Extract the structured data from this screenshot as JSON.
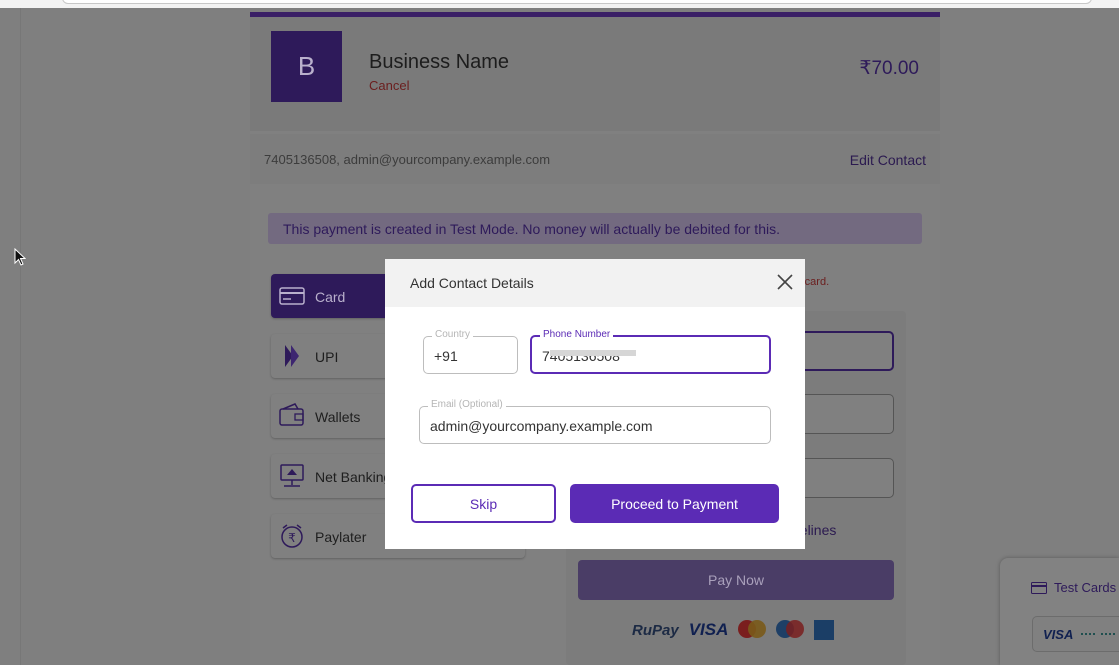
{
  "header": {
    "logo_letter": "B",
    "business_name": "Business Name",
    "cancel_label": "Cancel",
    "amount": "₹70.00"
  },
  "contact": {
    "summary": "7405136508, admin@yourcompany.example.com",
    "edit_label": "Edit Contact"
  },
  "test_mode_banner": "This payment is created in Test Mode. No money will actually be debited for this.",
  "debit_note_fragment": "bit card.",
  "payment_methods": [
    {
      "label": "Card",
      "icon": "card-icon",
      "active": true
    },
    {
      "label": "UPI",
      "icon": "upi-icon",
      "active": false
    },
    {
      "label": "Wallets",
      "icon": "wallet-icon",
      "active": false
    },
    {
      "label": "Net Banking",
      "icon": "net-banking-icon",
      "active": false
    },
    {
      "label": "Paylater",
      "icon": "paylater-icon",
      "active": false
    }
  ],
  "card_form": {
    "guidelines_fragment": "delines",
    "pay_now_label": "Pay Now",
    "network_logos": [
      "RuPay",
      "VISA",
      "mastercard",
      "maestro",
      "amex"
    ]
  },
  "test_cards": {
    "label": "Test Cards",
    "card_brand": "VISA"
  },
  "modal": {
    "title": "Add Contact Details",
    "country_label": "Country",
    "country_value": "+91",
    "phone_label": "Phone Number",
    "phone_value": "7405136508",
    "email_label": "Email (Optional)",
    "email_value": "admin@yourcompany.example.com",
    "skip_label": "Skip",
    "proceed_label": "Proceed to Payment"
  },
  "colors": {
    "brand": "#5b2bb5",
    "overlay_brand": "#2e1a5a",
    "error": "#d23b3b"
  }
}
